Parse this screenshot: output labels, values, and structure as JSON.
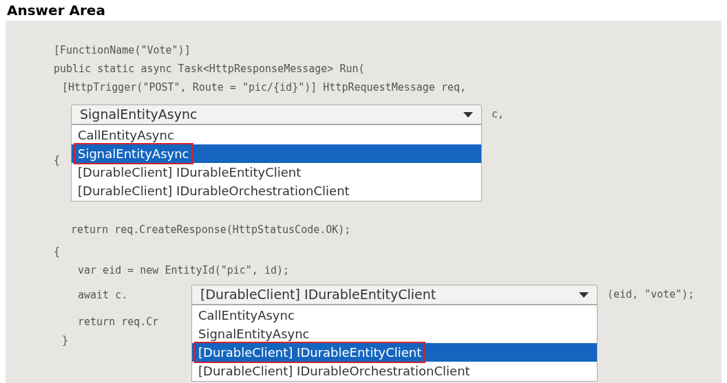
{
  "heading": "Answer Area",
  "code": [
    {
      "text": "[FunctionName(\"Vote\")]"
    },
    {
      "text": "public static async Task<HttpResponseMessage> Run(",
      "children": [
        {
          "kind": "text",
          "text": "[HttpTrigger(\"POST\", Route = \"pic/{id}\")] HttpRequestMessage req,"
        },
        {
          "kind": "dropdown",
          "value": "SignalEntityAsync",
          "suffix": "c,",
          "expanded": true,
          "options": [
            {
              "label": "CallEntityAsync",
              "selected": false
            },
            {
              "label": "SignalEntityAsync",
              "selected": true
            },
            {
              "label": "[DurableClient] IDurableEntityClient",
              "selected": false
            },
            {
              "label": "[DurableClient] IDurableOrchestrationClient",
              "selected": false
            }
          ]
        }
      ]
    },
    {
      "text": "{",
      "children": [
        {
          "kind": "text",
          "text": "return req.CreateResponse(HttpStatusCode.OK);"
        }
      ]
    },
    {
      "text": "{",
      "children": [
        {
          "kind": "text",
          "text": "var eid = new EntityId(\"pic\", id);"
        },
        {
          "kind": "dropdown",
          "prefix": "await c.",
          "value": "[DurableClient] IDurableEntityClient",
          "suffix": "(eid, \"vote\");",
          "expanded": true,
          "options": [
            {
              "label": "CallEntityAsync",
              "selected": false
            },
            {
              "label": "SignalEntityAsync",
              "selected": false
            },
            {
              "label": "[DurableClient] IDurableEntityClient",
              "selected": true
            },
            {
              "label": "[DurableClient] IDurableOrchestrationClient",
              "selected": false
            }
          ]
        },
        {
          "kind": "text",
          "text": "return req.Cr"
        }
      ]
    },
    {
      "text": "}"
    }
  ]
}
